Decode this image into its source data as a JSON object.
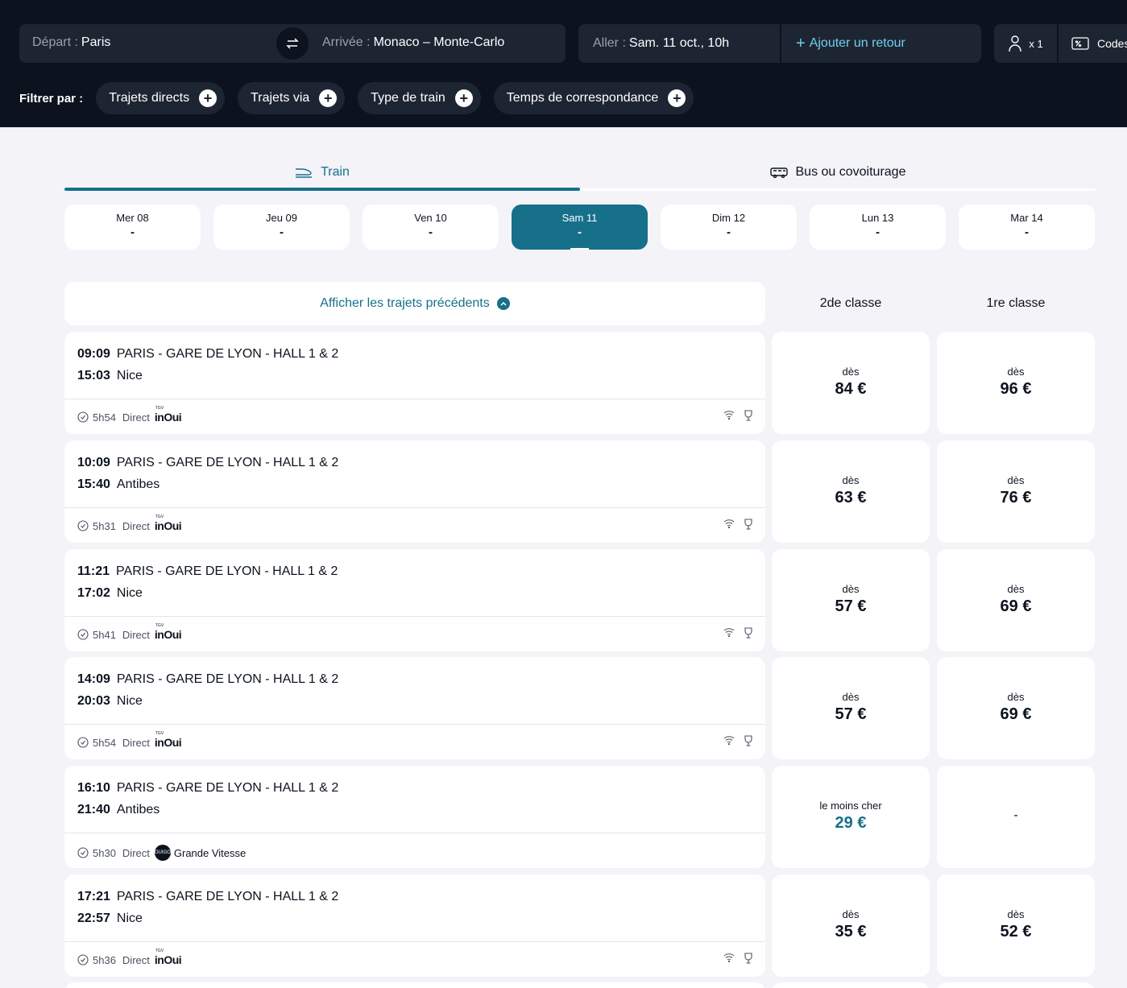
{
  "search": {
    "departure_label": "Départ :",
    "departure_value": "Paris",
    "arrival_label": "Arrivée :",
    "arrival_value": "Monaco – Monte-Carlo",
    "outbound_label": "Aller :",
    "outbound_value": "Sam. 11 oct., 10h",
    "add_return": "Ajouter un retour",
    "passengers": "x 1",
    "codes": "Codes"
  },
  "filters": {
    "label": "Filtrer par :",
    "chips": [
      "Trajets directs",
      "Trajets via",
      "Type de train",
      "Temps de correspondance"
    ]
  },
  "modes": {
    "train": "Train",
    "bus": "Bus ou covoiturage"
  },
  "dates": [
    {
      "label": "Mer 08",
      "price": "-"
    },
    {
      "label": "Jeu 09",
      "price": "-"
    },
    {
      "label": "Ven 10",
      "price": "-"
    },
    {
      "label": "Sam 11",
      "price": "-"
    },
    {
      "label": "Dim 12",
      "price": "-"
    },
    {
      "label": "Lun 13",
      "price": "-"
    },
    {
      "label": "Mar 14",
      "price": "-"
    }
  ],
  "results": {
    "show_previous": "Afficher les trajets précédents",
    "col_second": "2de classe",
    "col_first": "1re classe"
  },
  "trips": [
    {
      "dep_time": "09:09",
      "dep_station": "PARIS - GARE DE LYON - HALL 1 & 2",
      "arr_time": "15:03",
      "arr_station": "Nice",
      "duration": "5h54",
      "type": "Direct",
      "second_label": "dès",
      "second_price": "84 €",
      "first_label": "dès",
      "first_price": "96 €"
    },
    {
      "dep_time": "10:09",
      "dep_station": "PARIS - GARE DE LYON - HALL 1 & 2",
      "arr_time": "15:40",
      "arr_station": "Antibes",
      "duration": "5h31",
      "type": "Direct",
      "second_label": "dès",
      "second_price": "63 €",
      "first_label": "dès",
      "first_price": "76 €"
    },
    {
      "dep_time": "11:21",
      "dep_station": "PARIS - GARE DE LYON - HALL 1 & 2",
      "arr_time": "17:02",
      "arr_station": "Nice",
      "duration": "5h41",
      "type": "Direct",
      "second_label": "dès",
      "second_price": "57 €",
      "first_label": "dès",
      "first_price": "69 €"
    },
    {
      "dep_time": "14:09",
      "dep_station": "PARIS - GARE DE LYON - HALL 1 & 2",
      "arr_time": "20:03",
      "arr_station": "Nice",
      "duration": "5h54",
      "type": "Direct",
      "second_label": "dès",
      "second_price": "57 €",
      "first_label": "dès",
      "first_price": "69 €"
    },
    {
      "dep_time": "16:10",
      "dep_station": "PARIS - GARE DE LYON - HALL 1 & 2",
      "arr_time": "21:40",
      "arr_station": "Antibes",
      "duration": "5h30",
      "type": "Direct",
      "operator": "Grande Vitesse",
      "second_label": "le moins cher",
      "second_price": "29 €",
      "first_price": "-"
    },
    {
      "dep_time": "17:21",
      "dep_station": "PARIS - GARE DE LYON - HALL 1 & 2",
      "arr_time": "22:57",
      "arr_station": "Nice",
      "duration": "5h36",
      "type": "Direct",
      "second_label": "dès",
      "second_price": "35 €",
      "first_label": "dès",
      "first_price": "52 €"
    }
  ],
  "logos": {
    "inoui_small": "TGV",
    "inoui": "inOui",
    "ouigo": "OUIGO"
  },
  "colors": {
    "header_bg": "#0c131f",
    "accent": "#17708a",
    "link_cyan": "#6fd0ee"
  }
}
